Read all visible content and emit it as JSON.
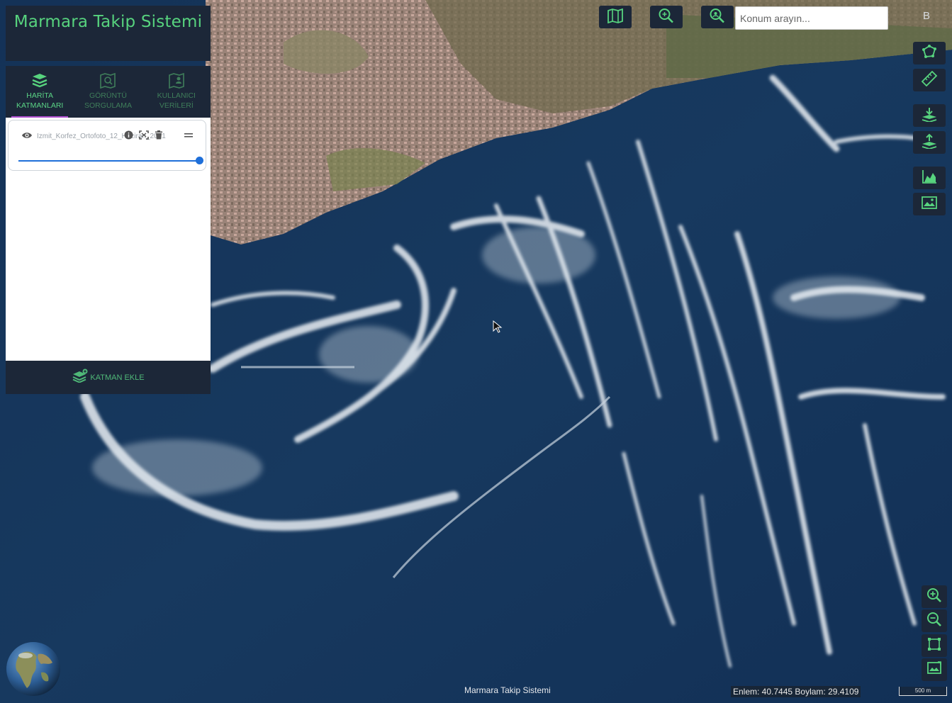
{
  "app": {
    "title": "Marmara Takip Sistemi"
  },
  "tabs": [
    {
      "label_line1": "HARİTA",
      "label_line2": "KATMANLARI",
      "icon": "layers-icon",
      "active": true
    },
    {
      "label_line1": "GÖRÜNTÜ",
      "label_line2": "SORGULAMA",
      "icon": "map-search-icon",
      "active": false
    },
    {
      "label_line1": "KULLANICI",
      "label_line2": "VERİLERİ",
      "icon": "user-map-icon",
      "active": false
    }
  ],
  "layers": [
    {
      "name": "Izmit_Korfez_Ortofoto_12_Haziran_2021",
      "visible": true,
      "opacity": 1.0
    }
  ],
  "add_layer": {
    "label": "KATMAN EKLE"
  },
  "top_toolbar": {
    "buttons": [
      "map-book-icon",
      "zoom-search-icon",
      "locate-search-icon"
    ],
    "search": {
      "placeholder": "Konum arayın...",
      "value": ""
    },
    "user_initial": "B"
  },
  "right_toolbar": [
    "polygon-draw-icon",
    "ruler-icon",
    "download-icon",
    "upload-icon",
    "chart-icon",
    "image-compare-icon"
  ],
  "zoom_controls": [
    "zoom-in-icon",
    "zoom-out-icon",
    "extent-icon",
    "image-export-icon"
  ],
  "footer": {
    "title": "Marmara Takip Sistemi",
    "coords": "Enlem: 40.7445 Boylam: 29.4109",
    "scale": "500 m"
  },
  "colors": {
    "panel": "#1c2738",
    "accent": "#57d37e",
    "tab_underline": "#b04fd0",
    "slider": "#1e6fd9"
  }
}
